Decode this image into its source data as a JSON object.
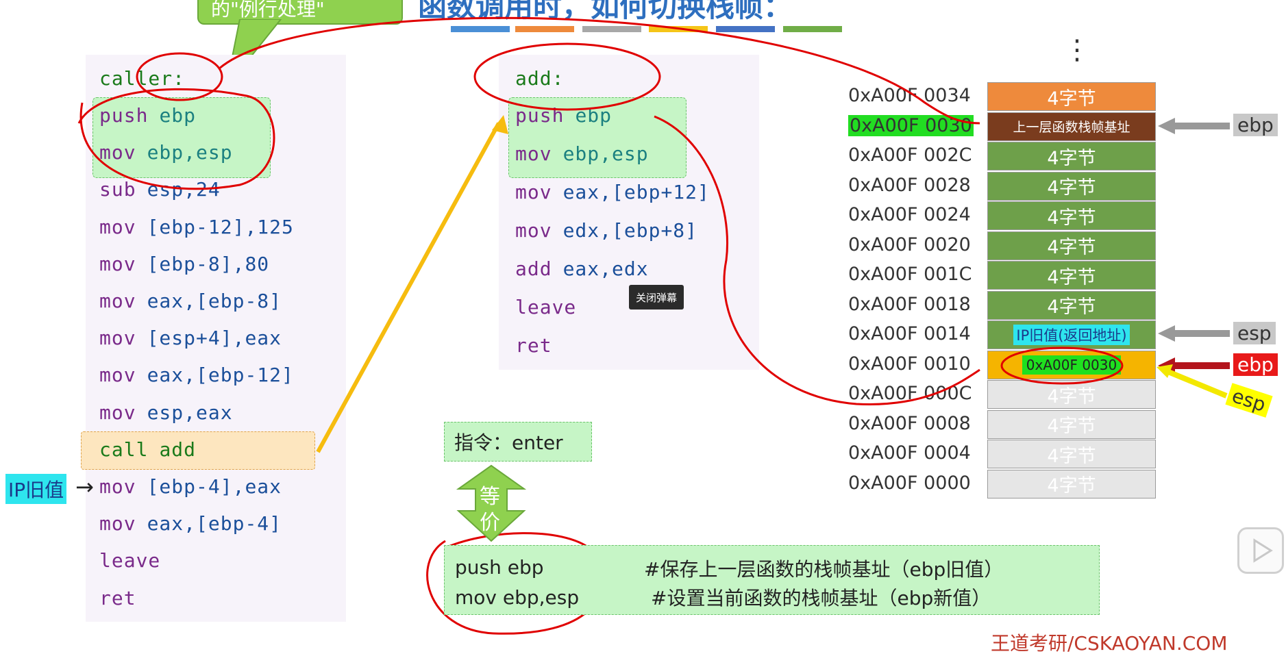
{
  "title": "函数调用时，如何切换栈帧：",
  "callout_text": "的\"例行处理\"",
  "strip_colors": [
    "#4a8fd6",
    "#ee8a3c",
    "#a8a8a8",
    "#f5c518",
    "#4472c4",
    "#70ad47"
  ],
  "caller": {
    "label": "caller:",
    "lines": [
      {
        "op": "push",
        "args": "ebp"
      },
      {
        "op": "mov",
        "args": "ebp,esp"
      },
      {
        "op": "sub",
        "args": "esp,24"
      },
      {
        "op": "mov",
        "args": "[ebp-12],125"
      },
      {
        "op": "mov",
        "args": "[ebp-8],80"
      },
      {
        "op": "mov",
        "args": "eax,[ebp-8]"
      },
      {
        "op": "mov",
        "args": "[esp+4],eax"
      },
      {
        "op": "mov",
        "args": "eax,[ebp-12]"
      },
      {
        "op": "mov",
        "args": "esp,eax"
      },
      {
        "op": "call",
        "args": "add"
      },
      {
        "op": "mov",
        "args": "[ebp-4],eax"
      },
      {
        "op": "mov",
        "args": "eax,[ebp-4]"
      },
      {
        "op": "leave",
        "args": ""
      },
      {
        "op": "ret",
        "args": ""
      }
    ],
    "ip_old_label": "IP旧值",
    "arrow": "→"
  },
  "callee": {
    "label": "add:",
    "lines": [
      {
        "op": "push",
        "args": "ebp"
      },
      {
        "op": "mov",
        "args": "ebp,esp"
      },
      {
        "op": "mov",
        "args": "eax,[ebp+12]"
      },
      {
        "op": "mov",
        "args": "edx,[ebp+8]"
      },
      {
        "op": "add",
        "args": "eax,edx"
      },
      {
        "op": "leave",
        "args": ""
      },
      {
        "op": "ret",
        "args": ""
      }
    ]
  },
  "tooltip": "关闭弹幕",
  "stack": {
    "dots": "⋮",
    "rows": [
      {
        "addr": "0xA00F 0034",
        "content": "4字节",
        "style": "o"
      },
      {
        "addr": "0xA00F 0030",
        "content": "上一层函数栈帧基址",
        "style": "dark",
        "addr_highlight": true
      },
      {
        "addr": "0xA00F 002C",
        "content": "4字节",
        "style": "g"
      },
      {
        "addr": "0xA00F 0028",
        "content": "4字节",
        "style": "g"
      },
      {
        "addr": "0xA00F 0024",
        "content": "4字节",
        "style": "g"
      },
      {
        "addr": "0xA00F 0020",
        "content": "4字节",
        "style": "g"
      },
      {
        "addr": "0xA00F 001C",
        "content": "4字节",
        "style": "g"
      },
      {
        "addr": "0xA00F 0018",
        "content": "4字节",
        "style": "g"
      },
      {
        "addr": "0xA00F 0014",
        "content": "IP旧值(返回地址)",
        "style": "g"
      },
      {
        "addr": "0xA00F 0010",
        "content": "0xA00F 0030",
        "style": "yel"
      },
      {
        "addr": "0xA00F 000C",
        "content": "4字节",
        "style": "gray"
      },
      {
        "addr": "0xA00F 0008",
        "content": "4字节",
        "style": "gray"
      },
      {
        "addr": "0xA00F 0004",
        "content": "4字节",
        "style": "gray"
      },
      {
        "addr": "0xA00F 0000",
        "content": "4字节",
        "style": "gray"
      }
    ],
    "pointers": {
      "ebp_old": "ebp",
      "esp_old": "esp",
      "ebp_new": "ebp",
      "esp_new": "esp"
    }
  },
  "instruction": {
    "label": "指令：enter",
    "equiv_top": "等",
    "equiv_bottom": "价",
    "lines": [
      {
        "code": "push ebp",
        "comment": "#保存上一层函数的栈帧基址（ebp旧值）"
      },
      {
        "code": "mov ebp,esp",
        "comment": "#设置当前函数的栈帧基址（ebp新值）"
      }
    ]
  },
  "watermark": "王道考研/CSKAOYAN.COM"
}
